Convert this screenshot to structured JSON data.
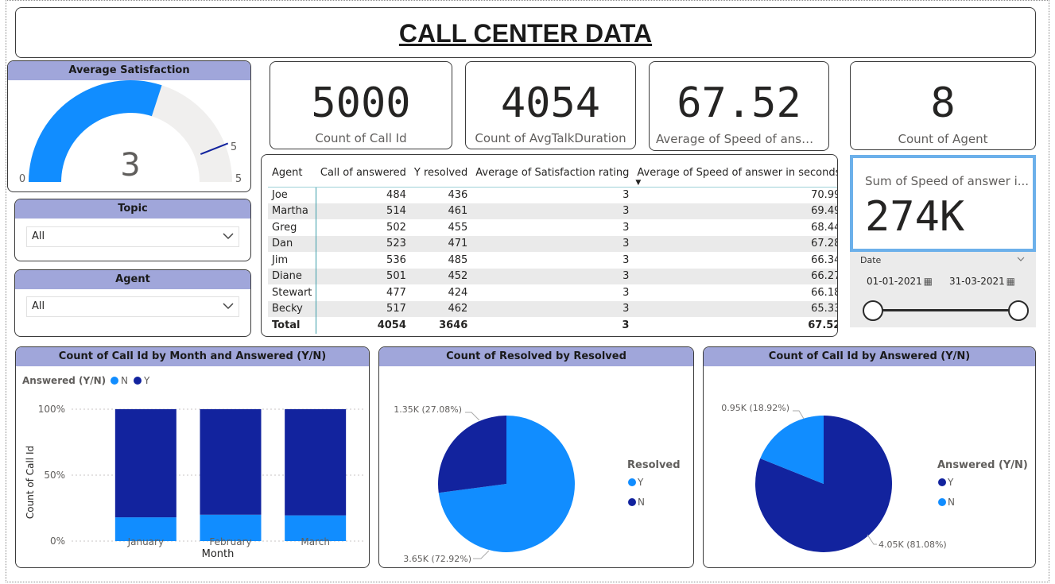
{
  "title": "CALL CENTER DATA",
  "gauge": {
    "title": "Average Satisfaction",
    "value": "3",
    "min": "0",
    "max": "5",
    "target": "5",
    "value_fraction": 0.6,
    "target_fraction": 1.0
  },
  "kpis": [
    {
      "value": "5000",
      "label": "Count of Call Id"
    },
    {
      "value": "4054",
      "label": "Count of AvgTalkDuration"
    },
    {
      "value": "67.52",
      "label": "Average of Speed of answe..."
    },
    {
      "value": "8",
      "label": "Count of Agent"
    }
  ],
  "sum_card": {
    "label": "Sum of Speed of answer i...",
    "value": "274K"
  },
  "topic_filter": {
    "title": "Topic",
    "value": "All"
  },
  "agent_filter": {
    "title": "Agent",
    "value": "All"
  },
  "date_slicer": {
    "title": "Date",
    "start": "01-01-2021",
    "end": "31-03-2021"
  },
  "table": {
    "headers": [
      "Agent",
      "Call of answered",
      "Y resolved",
      "Average of Satisfaction rating",
      "Average of Speed of answer in seconds"
    ],
    "rows": [
      [
        "Joe",
        "484",
        "436",
        "3",
        "70.99"
      ],
      [
        "Martha",
        "514",
        "461",
        "3",
        "69.49"
      ],
      [
        "Greg",
        "502",
        "455",
        "3",
        "68.44"
      ],
      [
        "Dan",
        "523",
        "471",
        "3",
        "67.28"
      ],
      [
        "Jim",
        "536",
        "485",
        "3",
        "66.34"
      ],
      [
        "Diane",
        "501",
        "452",
        "3",
        "66.27"
      ],
      [
        "Stewart",
        "477",
        "424",
        "3",
        "66.18"
      ],
      [
        "Becky",
        "517",
        "462",
        "3",
        "65.33"
      ]
    ],
    "total": [
      "Total",
      "4054",
      "3646",
      "3",
      "67.52"
    ]
  },
  "colors": {
    "light": "#118dff",
    "dark": "#12239e",
    "header": "#a0a6da"
  },
  "chart_data": [
    {
      "type": "bar",
      "title": "Count of Call Id by Month and Answered (Y/N)",
      "legend_title": "Answered (Y/N)",
      "legend_labels": [
        "N",
        "Y"
      ],
      "categories": [
        "January",
        "February",
        "March"
      ],
      "series": [
        {
          "name": "N",
          "values": [
            18,
            20,
            19.5
          ]
        },
        {
          "name": "Y",
          "values": [
            82,
            80,
            80.5
          ]
        }
      ],
      "xlabel": "Month",
      "ylabel": "Count of Call Id",
      "yticks": [
        "0%",
        "50%",
        "100%"
      ],
      "ylim": [
        0,
        100
      ],
      "stacked": "100%"
    },
    {
      "type": "pie",
      "title": "Count of Resolved by Resolved",
      "legend_title": "Resolved",
      "legend_labels": [
        "Y",
        "N"
      ],
      "slices": [
        {
          "name": "Y",
          "value": 72.92,
          "label": "3.65K (72.92%)"
        },
        {
          "name": "N",
          "value": 27.08,
          "label": "1.35K (27.08%)"
        }
      ]
    },
    {
      "type": "pie",
      "title": "Count of Call Id by Answered (Y/N)",
      "legend_title": "Answered (Y/N)",
      "legend_labels": [
        "Y",
        "N"
      ],
      "slices": [
        {
          "name": "Y",
          "value": 81.08,
          "label": "4.05K (81.08%)"
        },
        {
          "name": "N",
          "value": 18.92,
          "label": "0.95K (18.92%)"
        }
      ]
    }
  ]
}
